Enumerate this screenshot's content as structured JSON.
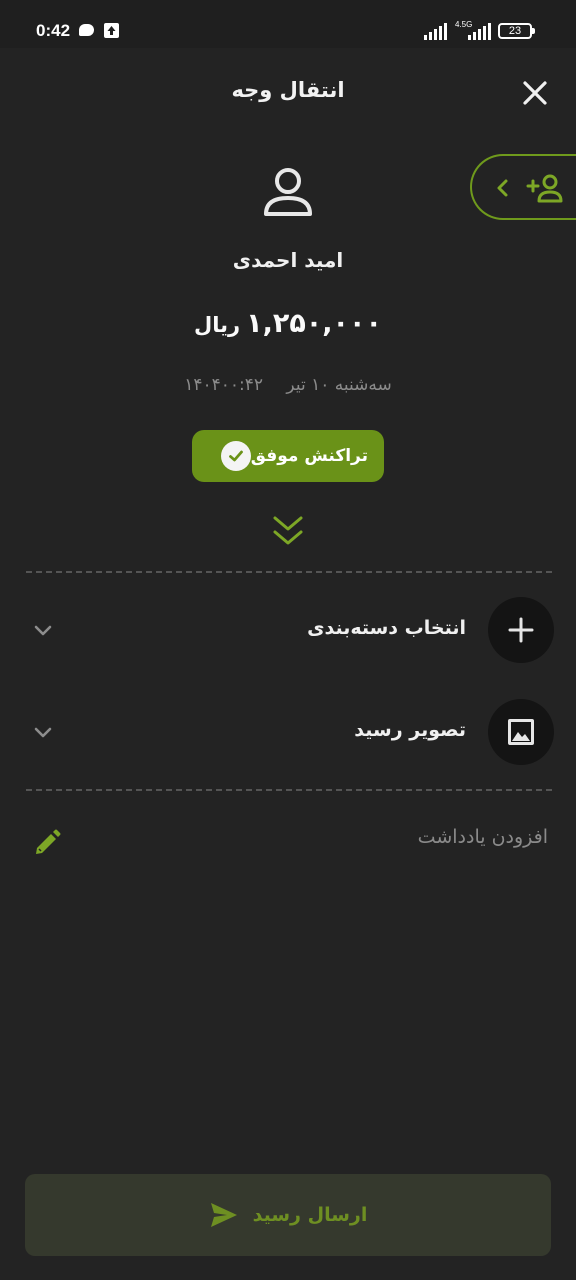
{
  "status_bar": {
    "time": "0:42",
    "network_type": "4.5G",
    "battery_level": "23"
  },
  "header": {
    "title": "انتقال وجه",
    "close_icon": "close-icon"
  },
  "add_contact": {
    "icons": [
      "chevron-left-icon",
      "person-add-icon"
    ]
  },
  "transaction": {
    "recipient_name": "امید احمدی",
    "amount": "۱,۲۵۰,۰۰۰",
    "currency": "ریال",
    "date": "سه‌شنبه ۱۰ تیر ۱۴۰۴",
    "time": "۰۰:۴۲",
    "status_label": "تراکنش موفق",
    "status_color": "#6a9218"
  },
  "options": [
    {
      "label": "انتخاب دسته‌بندی",
      "icon": "plus-icon"
    },
    {
      "label": "تصویر رسید",
      "icon": "image-icon"
    }
  ],
  "note": {
    "placeholder": "افزودن یادداشت"
  },
  "send_button": {
    "label": "ارسال رسید",
    "icon": "send-icon"
  },
  "accent_color": "#6f9a1c"
}
